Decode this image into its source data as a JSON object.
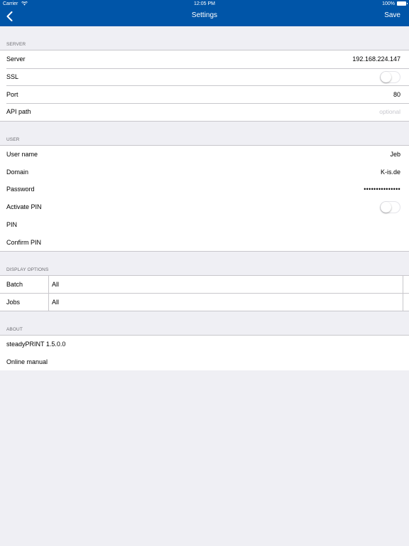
{
  "status_bar": {
    "carrier": "Carrier",
    "time": "12:05 PM",
    "battery": "100%"
  },
  "nav": {
    "back_icon": "chevron-left-icon",
    "title": "Settings",
    "save_label": "Save"
  },
  "server": {
    "header": "SERVER",
    "server_label": "Server",
    "server_value": "192.168.224.147",
    "ssl_label": "SSL",
    "ssl_on": false,
    "port_label": "Port",
    "port_value": "80",
    "api_label": "API path",
    "api_placeholder": "optional"
  },
  "user": {
    "header": "USER",
    "username_label": "User name",
    "username_value": "Jeb",
    "domain_label": "Domain",
    "domain_value": "K-is.de",
    "password_label": "Password",
    "password_value": "•••••••••••••••",
    "pin_label": "Activate PIN",
    "pin_on": false,
    "pin_field_label": "PIN",
    "confirm_pin_label": "Confirm PIN"
  },
  "display": {
    "header": "DISPLAY OPTIONS",
    "batch_label": "Batch",
    "batch_value": "All",
    "jobs_label": "Jobs",
    "jobs_value": "All"
  },
  "about": {
    "header": "ABOUT",
    "version": "steadyPRINT 1.5.0.0",
    "manual": "Online manual"
  },
  "colors": {
    "nav_bar": "#0055a8",
    "background": "#efeff4"
  }
}
